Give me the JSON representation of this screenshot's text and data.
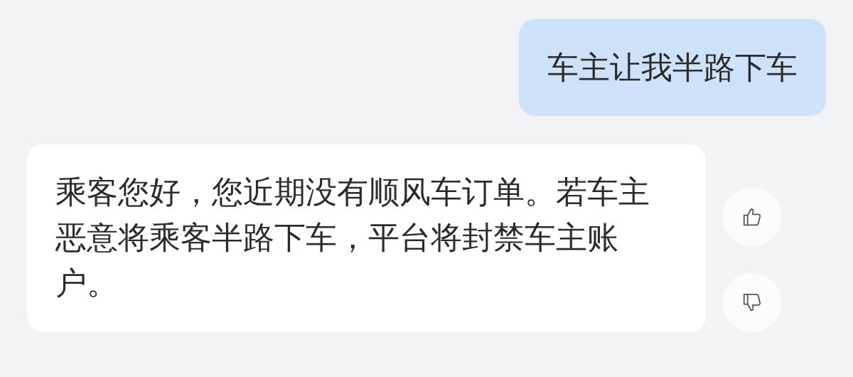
{
  "messages": [
    {
      "kind": "user",
      "text": "车主让我半路下车"
    },
    {
      "kind": "assistant",
      "text": "乘客您好，您近期没有顺风车订单。若车主恶意将乘客半路下车，平台将封禁车主账户。"
    }
  ]
}
